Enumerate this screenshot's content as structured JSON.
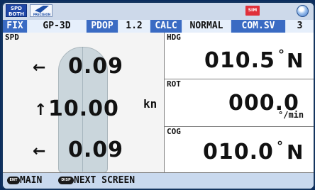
{
  "iconbar": {
    "spd_icon_line1": "SPD",
    "spd_icon_line2": "BOTH",
    "precision_text": "PRECISION",
    "sim_badge": "SIM"
  },
  "status": {
    "fix_label": "FIX",
    "fix_value": "GP-3D",
    "pdop_label": "PDOP",
    "pdop_value": "1.2",
    "calc_label": "CALC",
    "calc_value": "NORMAL",
    "com_label": "COM.SV",
    "com_value": "3"
  },
  "spd": {
    "label": "SPD",
    "top_value": "0.09",
    "mid_value": "10.00",
    "bottom_value": "0.09",
    "unit": "kn",
    "top_arrow": "←",
    "mid_arrow": "↑",
    "bottom_arrow": "←"
  },
  "hdg": {
    "label": "HDG",
    "value": "010.5",
    "deg": "°",
    "unit": "N"
  },
  "rot": {
    "label": "ROT",
    "value": "000.0",
    "unit": "°/min"
  },
  "cog": {
    "label": "COG",
    "value": "010.0",
    "deg": "°",
    "unit": "N"
  },
  "softkeys": {
    "ent_key": "ENT",
    "ent_label": "MAIN",
    "disp_key": "DISP",
    "disp_label": "NEXT SCREEN"
  }
}
